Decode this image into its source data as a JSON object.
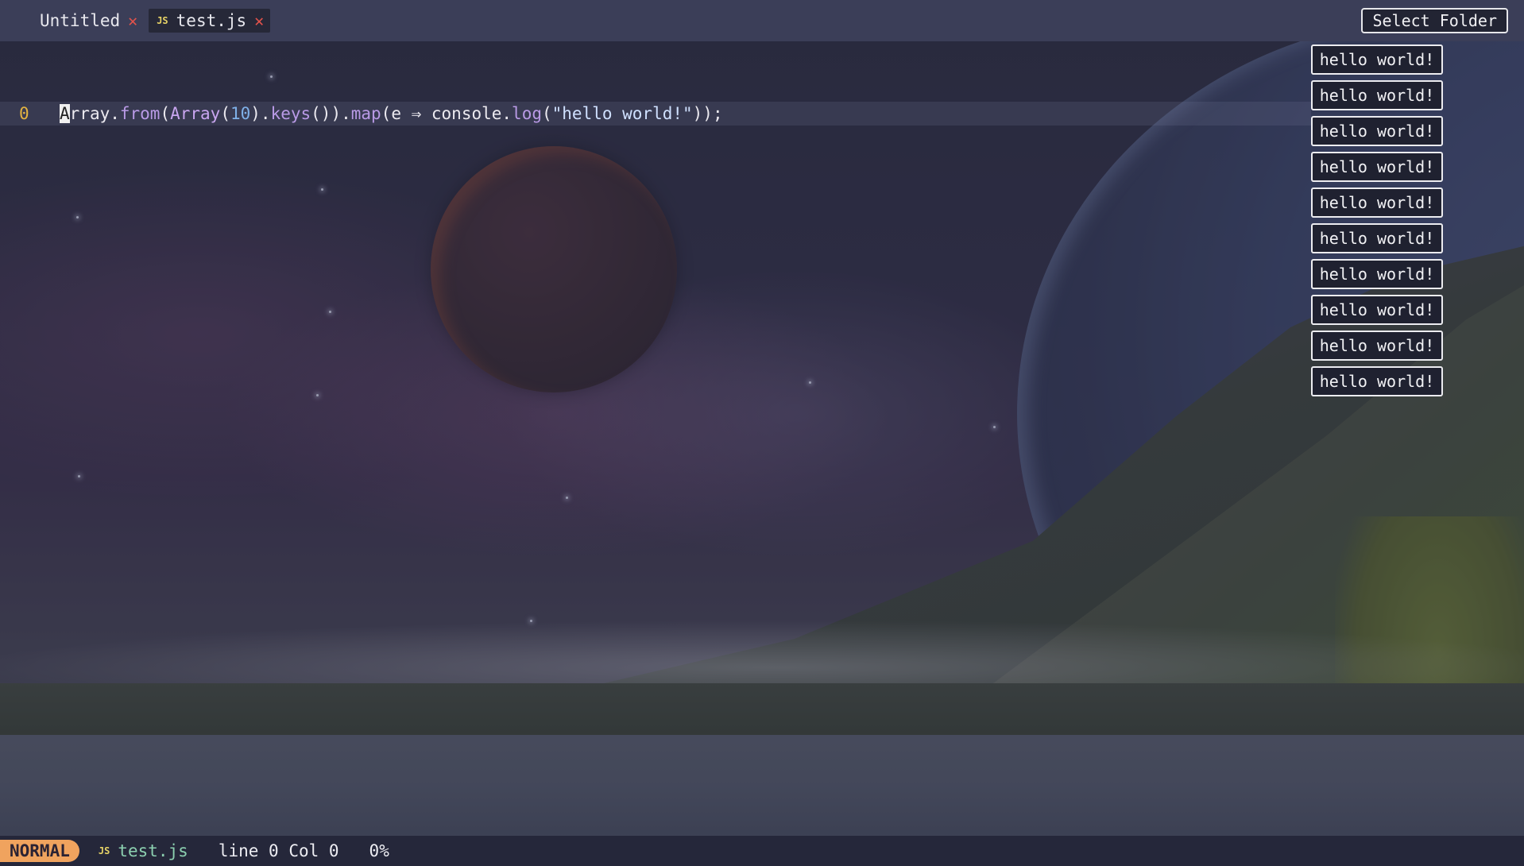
{
  "tabs": [
    {
      "label": "Untitled",
      "icon": "",
      "close_icon": "close-icon"
    },
    {
      "label": "test.js",
      "icon": "JS",
      "close_icon": "close-icon"
    }
  ],
  "header": {
    "select_folder_label": "Select Folder"
  },
  "editor": {
    "line_number": "0",
    "code": {
      "cursor_char": "A",
      "t1": "rray.",
      "t2": "from",
      "t3": "(",
      "t4": "Array",
      "t5": "(",
      "t6": "10",
      "t7": ").",
      "t8": "keys",
      "t9": "()).",
      "t10": "map",
      "t11": "(e ⇒ console.",
      "t12": "log",
      "t13": "(",
      "t14": "\"hello world!\"",
      "t15": "));"
    }
  },
  "output": [
    "hello world!",
    "hello world!",
    "hello world!",
    "hello world!",
    "hello world!",
    "hello world!",
    "hello world!",
    "hello world!",
    "hello world!",
    "hello world!"
  ],
  "status": {
    "mode": "NORMAL",
    "file_icon": "JS",
    "file": "test.js",
    "position": "line 0 Col 0",
    "percent": "0%"
  },
  "colors": {
    "tab_close": "#e5534b",
    "mode_badge": "#f0a35e",
    "line_number": "#e3b341",
    "file_name": "#8cd0b0"
  }
}
